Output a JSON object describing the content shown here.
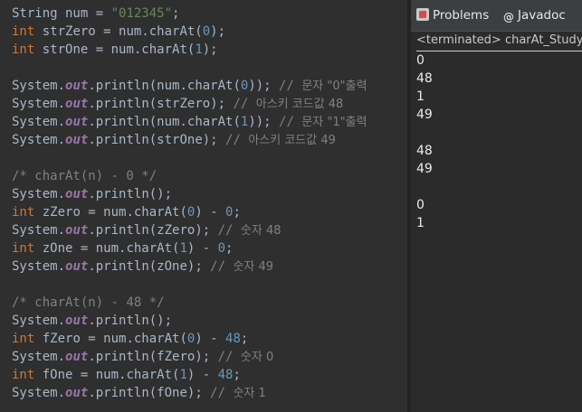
{
  "editor": {
    "lines": [
      {
        "tokens": [
          {
            "c": "t-class",
            "t": "String"
          },
          {
            "c": "t-var",
            "t": " num = "
          },
          {
            "c": "t-str",
            "t": "\"012345\""
          },
          {
            "c": "t-punc",
            "t": ";"
          }
        ]
      },
      {
        "tokens": [
          {
            "c": "t-type",
            "t": "int"
          },
          {
            "c": "t-var",
            "t": " strZero = num.charAt("
          },
          {
            "c": "t-num",
            "t": "0"
          },
          {
            "c": "t-punc",
            "t": ");"
          }
        ]
      },
      {
        "tokens": [
          {
            "c": "t-type",
            "t": "int"
          },
          {
            "c": "t-var",
            "t": " strOne = num.charAt("
          },
          {
            "c": "t-num",
            "t": "1"
          },
          {
            "c": "t-punc",
            "t": ");"
          }
        ]
      },
      {
        "tokens": []
      },
      {
        "tokens": [
          {
            "c": "t-class",
            "t": "System."
          },
          {
            "c": "t-field",
            "t": "out"
          },
          {
            "c": "t-method",
            "t": ".println(num.charAt("
          },
          {
            "c": "t-num",
            "t": "0"
          },
          {
            "c": "t-punc",
            "t": ")); "
          },
          {
            "c": "t-comment",
            "t": "// "
          },
          {
            "c": "t-cmt-txt",
            "t": "문자 \"0\"출력"
          }
        ]
      },
      {
        "tokens": [
          {
            "c": "t-class",
            "t": "System."
          },
          {
            "c": "t-field",
            "t": "out"
          },
          {
            "c": "t-method",
            "t": ".println(strZero); "
          },
          {
            "c": "t-comment",
            "t": "// "
          },
          {
            "c": "t-cmt-txt",
            "t": "아스키 코드값 48"
          }
        ]
      },
      {
        "tokens": [
          {
            "c": "t-class",
            "t": "System."
          },
          {
            "c": "t-field",
            "t": "out"
          },
          {
            "c": "t-method",
            "t": ".println(num.charAt("
          },
          {
            "c": "t-num",
            "t": "1"
          },
          {
            "c": "t-punc",
            "t": ")); "
          },
          {
            "c": "t-comment",
            "t": "// "
          },
          {
            "c": "t-cmt-txt",
            "t": "문자 \"1\"출력"
          }
        ]
      },
      {
        "tokens": [
          {
            "c": "t-class",
            "t": "System."
          },
          {
            "c": "t-field",
            "t": "out"
          },
          {
            "c": "t-method",
            "t": ".println(strOne); "
          },
          {
            "c": "t-comment",
            "t": "// "
          },
          {
            "c": "t-cmt-txt",
            "t": "아스키 코드값 49"
          }
        ]
      },
      {
        "tokens": []
      },
      {
        "tokens": [
          {
            "c": "t-comment",
            "t": "/* charAt(n) - 0 */"
          }
        ]
      },
      {
        "tokens": [
          {
            "c": "t-class",
            "t": "System."
          },
          {
            "c": "t-field",
            "t": "out"
          },
          {
            "c": "t-method",
            "t": ".println();"
          }
        ]
      },
      {
        "tokens": [
          {
            "c": "t-type",
            "t": "int"
          },
          {
            "c": "t-var",
            "t": " zZero = num.charAt("
          },
          {
            "c": "t-num",
            "t": "0"
          },
          {
            "c": "t-punc",
            "t": ") - "
          },
          {
            "c": "t-num",
            "t": "0"
          },
          {
            "c": "t-punc",
            "t": ";"
          }
        ]
      },
      {
        "tokens": [
          {
            "c": "t-class",
            "t": "System."
          },
          {
            "c": "t-field",
            "t": "out"
          },
          {
            "c": "t-method",
            "t": ".println(zZero); "
          },
          {
            "c": "t-comment",
            "t": "// "
          },
          {
            "c": "t-cmt-txt",
            "t": "숫자 48"
          }
        ]
      },
      {
        "tokens": [
          {
            "c": "t-type",
            "t": "int"
          },
          {
            "c": "t-var",
            "t": " zOne = num.charAt("
          },
          {
            "c": "t-num",
            "t": "1"
          },
          {
            "c": "t-punc",
            "t": ") - "
          },
          {
            "c": "t-num",
            "t": "0"
          },
          {
            "c": "t-punc",
            "t": ";"
          }
        ]
      },
      {
        "tokens": [
          {
            "c": "t-class",
            "t": "System."
          },
          {
            "c": "t-field",
            "t": "out"
          },
          {
            "c": "t-method",
            "t": ".println(zOne); "
          },
          {
            "c": "t-comment",
            "t": "// "
          },
          {
            "c": "t-cmt-txt",
            "t": "숫자 49"
          }
        ]
      },
      {
        "tokens": []
      },
      {
        "tokens": [
          {
            "c": "t-comment",
            "t": "/* charAt(n) - 48 */"
          }
        ]
      },
      {
        "tokens": [
          {
            "c": "t-class",
            "t": "System."
          },
          {
            "c": "t-field",
            "t": "out"
          },
          {
            "c": "t-method",
            "t": ".println();"
          }
        ]
      },
      {
        "tokens": [
          {
            "c": "t-type",
            "t": "int"
          },
          {
            "c": "t-var",
            "t": " fZero = num.charAt("
          },
          {
            "c": "t-num",
            "t": "0"
          },
          {
            "c": "t-punc",
            "t": ") - "
          },
          {
            "c": "t-num",
            "t": "48"
          },
          {
            "c": "t-punc",
            "t": ";"
          }
        ]
      },
      {
        "tokens": [
          {
            "c": "t-class",
            "t": "System."
          },
          {
            "c": "t-field",
            "t": "out"
          },
          {
            "c": "t-method",
            "t": ".println(fZero); "
          },
          {
            "c": "t-comment",
            "t": "// "
          },
          {
            "c": "t-cmt-txt",
            "t": "숫자 0"
          }
        ]
      },
      {
        "tokens": [
          {
            "c": "t-type",
            "t": "int"
          },
          {
            "c": "t-var",
            "t": " fOne = num.charAt("
          },
          {
            "c": "t-num",
            "t": "1"
          },
          {
            "c": "t-punc",
            "t": ") - "
          },
          {
            "c": "t-num",
            "t": "48"
          },
          {
            "c": "t-punc",
            "t": ";"
          }
        ]
      },
      {
        "tokens": [
          {
            "c": "t-class",
            "t": "System."
          },
          {
            "c": "t-field",
            "t": "out"
          },
          {
            "c": "t-method",
            "t": ".println(fOne); "
          },
          {
            "c": "t-comment",
            "t": "// "
          },
          {
            "c": "t-cmt-txt",
            "t": "숫자 1"
          }
        ]
      }
    ]
  },
  "console": {
    "tabs": {
      "problems": {
        "label": "Problems",
        "icon": "problems-icon"
      },
      "javadoc": {
        "label": "Javadoc",
        "icon": "javadoc-at-icon"
      }
    },
    "terminated_label": "<terminated> charAt_Study",
    "output": [
      "0",
      "48",
      "1",
      "49",
      "",
      "48",
      "49",
      "",
      "0",
      "1"
    ]
  }
}
